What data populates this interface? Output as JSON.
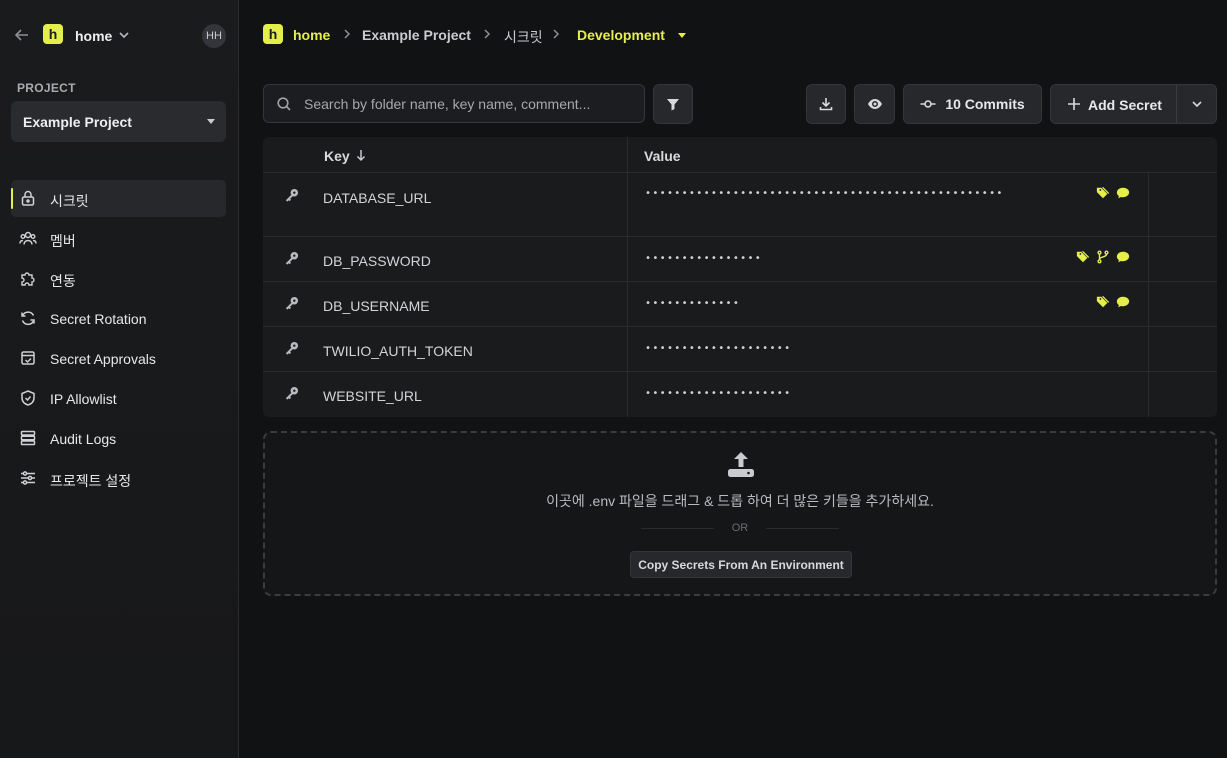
{
  "sidebar": {
    "org_name": "home",
    "org_logo_letter": "h",
    "avatar_initials": "HH",
    "project_label": "PROJECT",
    "project_selected": "Example Project",
    "items": [
      {
        "label": "시크릿",
        "icon": "lock-icon",
        "active": true
      },
      {
        "label": "멤버",
        "icon": "members-icon"
      },
      {
        "label": "연동",
        "icon": "puzzle-icon"
      },
      {
        "label": "Secret Rotation",
        "icon": "rotate-icon"
      },
      {
        "label": "Secret Approvals",
        "icon": "approval-icon"
      },
      {
        "label": "IP Allowlist",
        "icon": "shield-icon"
      },
      {
        "label": "Audit Logs",
        "icon": "list-icon"
      },
      {
        "label": "프로젝트 설정",
        "icon": "sliders-icon"
      }
    ]
  },
  "breadcrumb": {
    "logo_letter": "h",
    "home": "home",
    "project": "Example Project",
    "section": "시크릿",
    "environment": "Development"
  },
  "toolbar": {
    "search_placeholder": "Search by folder name, key name, comment...",
    "commits_label": "10 Commits",
    "add_secret_label": "Add Secret"
  },
  "table": {
    "col_key": "Key",
    "col_value": "Value",
    "rows": [
      {
        "key": "DATABASE_URL",
        "value": "•••••••••••••••••••••••••••••••••••••••••••••••••",
        "tags": [
          "tag-icon",
          "comment-icon"
        ]
      },
      {
        "key": "DB_PASSWORD",
        "value": "••••••••••••••••",
        "tags": [
          "tag-icon",
          "branch-icon",
          "comment-icon"
        ]
      },
      {
        "key": "DB_USERNAME",
        "value": "•••••••••••••",
        "tags": [
          "tag-icon",
          "comment-icon"
        ]
      },
      {
        "key": "TWILIO_AUTH_TOKEN",
        "value": "••••••••••••••••••••",
        "tags": []
      },
      {
        "key": "WEBSITE_URL",
        "value": "••••••••••••••••••••",
        "tags": []
      }
    ]
  },
  "dropzone": {
    "text": "이곳에 .env 파일을 드래그 & 드롭 하여 더 많은 키들을 추가하세요.",
    "or": "OR",
    "copy_button": "Copy Secrets From An Environment"
  },
  "colors": {
    "accent": "#e5ef4b",
    "background": "#111214",
    "sidebar": "#1a1b1d"
  }
}
